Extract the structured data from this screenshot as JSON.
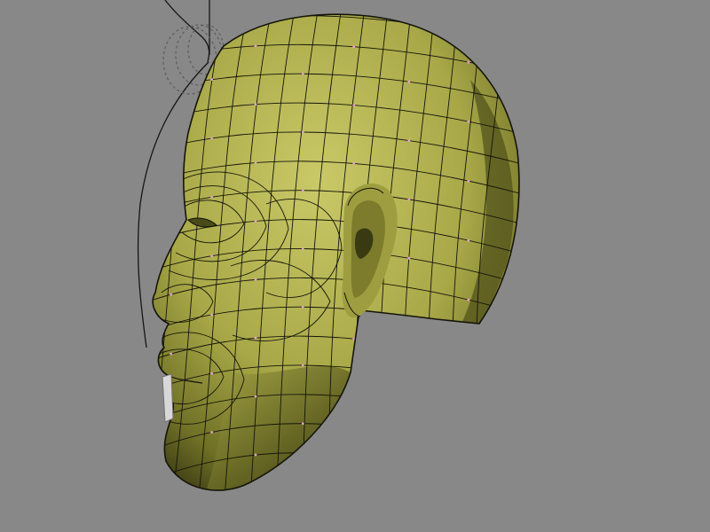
{
  "viewport": {
    "background_color": "#888888"
  },
  "head_model": {
    "base_color": "#b3b34d",
    "wire_color": "#14140a",
    "vertex_color": "#e6a0d2",
    "display_mode": "solid-with-wireframe-overlay"
  },
  "reference_curves": {
    "line_color": "#151515",
    "guide_color": "#5c5c5c"
  },
  "icons": {
    "tooth_object": "tooth-object"
  }
}
